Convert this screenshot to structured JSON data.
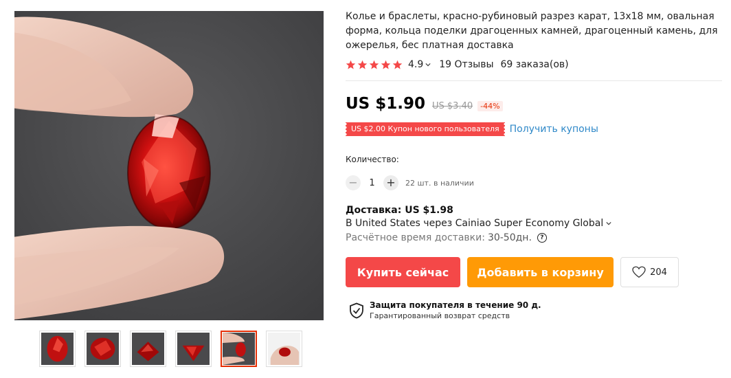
{
  "product": {
    "title": "Колье и браслеты, красно-рубиновый разрез карат, 13x18 мм, овальная форма, кольца поделки драгоценных камней, драгоценный камень, для ожерелья, бес платная доставка",
    "rating": "4.9",
    "reviews": "19 Отзывы",
    "orders": "69 заказа(ов)",
    "star_color": "#f44848"
  },
  "gallery": {
    "main_image": "ruby-oval-gem-held-in-fingers",
    "thumbnails": [
      {
        "name": "ruby-front-thumb"
      },
      {
        "name": "ruby-angle-thumb"
      },
      {
        "name": "ruby-side-thumb"
      },
      {
        "name": "ruby-pavilion-thumb"
      },
      {
        "name": "ruby-in-hand-thumb",
        "active": true
      },
      {
        "name": "ruby-on-palm-thumb"
      }
    ]
  },
  "price": {
    "current": "US $1.90",
    "original": "US $3.40",
    "discount": "-44%"
  },
  "coupon": {
    "label": "US $2.00 Купон нового пользователя",
    "link": "Получить купоны"
  },
  "quantity": {
    "label": "Количество:",
    "minus": "−",
    "value": "1",
    "plus": "+",
    "stock": "22 шт. в наличии"
  },
  "shipping": {
    "title": "Доставка: US $1.98",
    "method": "В United States через Cainiao Super Economy Global",
    "eta_label": "Расчётное время доставки:",
    "eta_value": "30-50дн.",
    "help": "?"
  },
  "actions": {
    "buy_now": "Купить сейчас",
    "add_to_cart": "Добавить в корзину",
    "wishlist_count": "204"
  },
  "protection": {
    "title": "Защита покупателя в течение 90 д.",
    "subtitle": "Гарантированный возврат средств"
  },
  "colors": {
    "accent_red": "#f44848",
    "cart_orange": "#ff9a06",
    "link_blue": "#2e88c8"
  }
}
